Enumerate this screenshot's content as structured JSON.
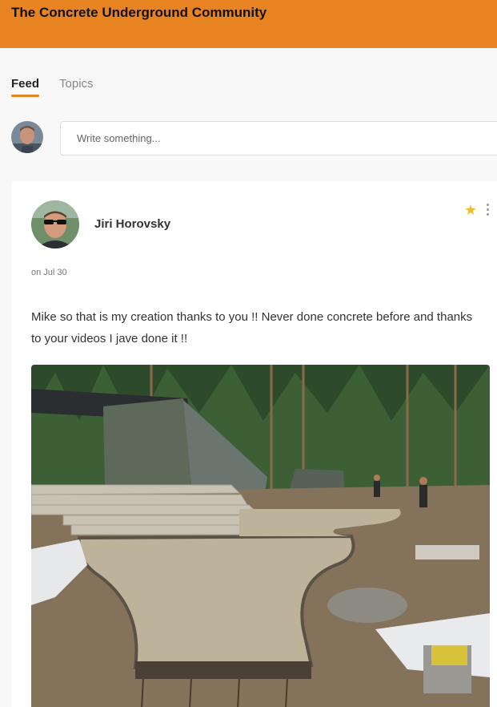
{
  "header": {
    "title": "The Concrete Underground Community"
  },
  "tabs": [
    {
      "label": "Feed",
      "active": true
    },
    {
      "label": "Topics",
      "active": false
    }
  ],
  "composer": {
    "placeholder": "Write something..."
  },
  "post": {
    "author": "Jiri Horovsky",
    "date": "on Jul 30",
    "body": "Mike so that is my creation thanks to you !! Never done concrete before and thanks to your videos I jave done it !!",
    "starred": true,
    "star_icon": "star-icon",
    "menu_icon": "more-vertical-icon",
    "image_alt": "concrete walkway construction photo"
  },
  "colors": {
    "brand": "#e88322",
    "star": "#f5bd2a"
  }
}
